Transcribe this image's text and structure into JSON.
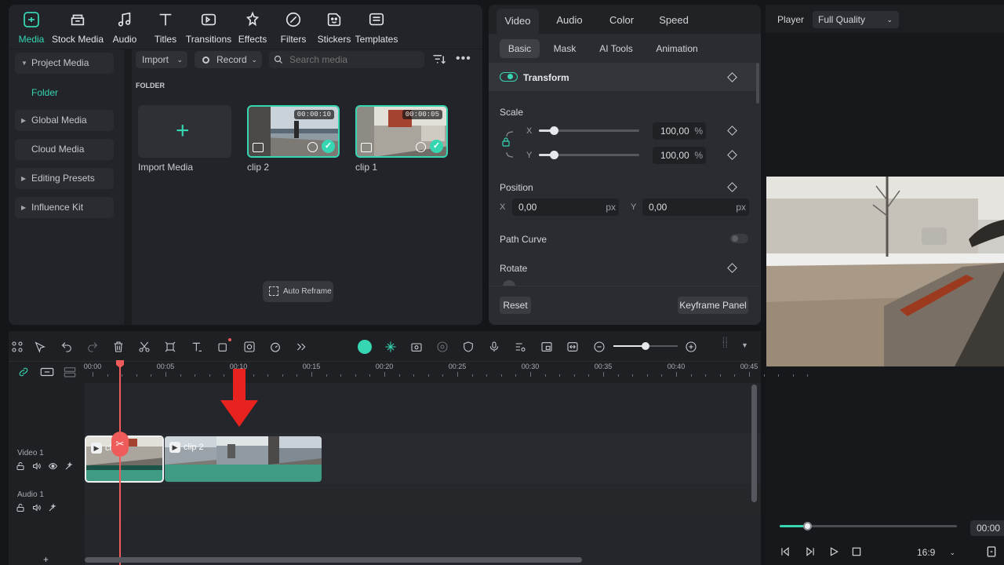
{
  "top_tabs": [
    {
      "label": "Media",
      "icon": "media-icon"
    },
    {
      "label": "Stock Media",
      "icon": "stock-media-icon"
    },
    {
      "label": "Audio",
      "icon": "audio-icon"
    },
    {
      "label": "Titles",
      "icon": "titles-icon"
    },
    {
      "label": "Transitions",
      "icon": "transitions-icon"
    },
    {
      "label": "Effects",
      "icon": "effects-icon"
    },
    {
      "label": "Filters",
      "icon": "filters-icon"
    },
    {
      "label": "Stickers",
      "icon": "stickers-icon"
    },
    {
      "label": "Templates",
      "icon": "templates-icon"
    }
  ],
  "sidebar": {
    "project_media": "Project Media",
    "folder": "Folder",
    "global_media": "Global Media",
    "cloud_media": "Cloud Media",
    "editing_presets": "Editing Presets",
    "influence_kit": "Influence Kit"
  },
  "media_toolbar": {
    "import": "Import",
    "record": "Record",
    "search_placeholder": "Search media"
  },
  "folder_heading": "FOLDER",
  "media_items": {
    "import_label": "Import Media",
    "clip2_label": "clip 2",
    "clip2_duration": "00:00:10",
    "clip1_label": "clip 1",
    "clip1_duration": "00:00:05"
  },
  "auto_reframe": "Auto Reframe",
  "property_tabs": [
    "Video",
    "Audio",
    "Color",
    "Speed"
  ],
  "property_subtabs": [
    "Basic",
    "Mask",
    "AI Tools",
    "Animation"
  ],
  "properties": {
    "transform": "Transform",
    "scale": "Scale",
    "scale_x_label": "X",
    "scale_y_label": "Y",
    "scale_x_value": "100,00",
    "scale_y_value": "100,00",
    "percent": "%",
    "position": "Position",
    "pos_x_label": "X",
    "pos_y_label": "Y",
    "pos_x_value": "0,00",
    "pos_y_value": "0,00",
    "px": "px",
    "path_curve": "Path Curve",
    "rotate": "Rotate",
    "reset": "Reset",
    "keyframe_panel": "Keyframe Panel",
    "scale_slider_fraction": 0.15
  },
  "player": {
    "label": "Player",
    "quality": "Full Quality",
    "timecode": "00:00",
    "aspect": "16:9",
    "progress_fraction": 0.16
  },
  "timeline": {
    "ruler": [
      "00:00",
      "00:05",
      "00:10",
      "00:15",
      "00:20",
      "00:25",
      "00:30",
      "00:35",
      "00:40",
      "00:45"
    ],
    "video_track": "Video 1",
    "audio_track": "Audio 1",
    "clip2_label": "clip 2",
    "clip1_label_partial": "cli",
    "add": "+",
    "zoom_fraction": 0.5
  },
  "colors": {
    "accent": "#36d6b3",
    "playhead": "#ef5a5a",
    "arrow": "#e8231f",
    "clip_green": "#3f9b83"
  }
}
